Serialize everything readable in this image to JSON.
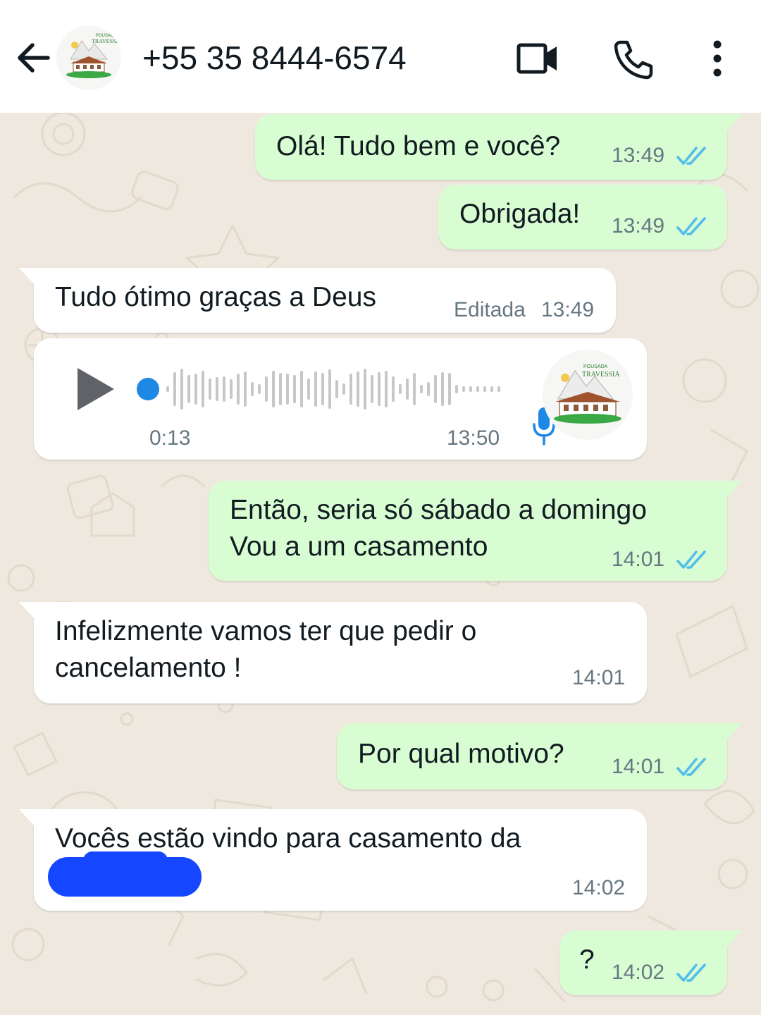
{
  "header": {
    "contact_name": "+55 35 8444-6574",
    "avatar_text_top": "POUSADA",
    "avatar_text_main": "TRAVESSIA"
  },
  "messages": [
    {
      "direction": "outgoing",
      "text": "Olá! Tudo bem e você?",
      "time": "13:49",
      "status": "read"
    },
    {
      "direction": "outgoing",
      "text": "Obrigada!",
      "time": "13:49",
      "status": "read"
    },
    {
      "direction": "incoming",
      "text": "Tudo ótimo graças a Deus",
      "edited_label": "Editada",
      "time": "13:49"
    },
    {
      "direction": "incoming",
      "type": "voice",
      "duration": "0:13",
      "time": "13:50"
    },
    {
      "direction": "outgoing",
      "lines": [
        "Então, seria só sábado a domingo",
        "Vou a um casamento"
      ],
      "time": "14:01",
      "status": "read"
    },
    {
      "direction": "incoming",
      "lines": [
        "Infelizmente vamos ter que pedir o",
        "cancelamento !"
      ],
      "time": "14:01"
    },
    {
      "direction": "outgoing",
      "text": "Por qual motivo?",
      "time": "14:01",
      "status": "read"
    },
    {
      "direction": "incoming",
      "text": "Vocês estão vindo para casamento da",
      "redacted": true,
      "time": "14:02"
    },
    {
      "direction": "outgoing",
      "text": "?",
      "time": "14:02",
      "status": "read"
    }
  ],
  "colors": {
    "outgoing_bubble": "#d9fdd3",
    "incoming_bubble": "#ffffff",
    "read_ticks": "#53bdeb",
    "chat_background": "#efe8df",
    "redaction": "#1447ff"
  }
}
